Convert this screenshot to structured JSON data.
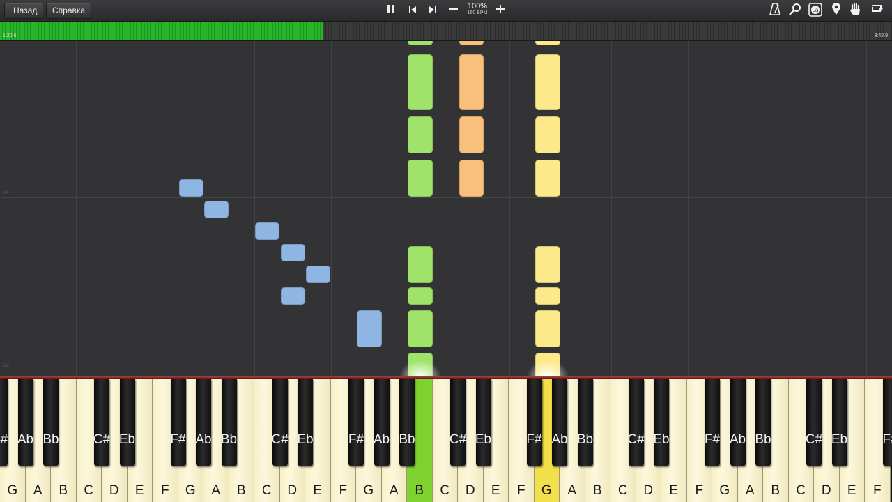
{
  "topbar": {
    "back_label": "Назад",
    "help_label": "Справка",
    "speed_percent": "100%",
    "tempo": "160 BPM"
  },
  "icons": {
    "pause": "pause-icon",
    "prev": "skip-back-icon",
    "next": "skip-forward-icon",
    "minus": "minus-icon",
    "plus": "plus-icon",
    "metronome": "metronome-icon",
    "search": "search-icon",
    "labels": "note-labels-icon",
    "marker": "location-marker-icon",
    "hand": "hand-icon",
    "loop": "loop-icon"
  },
  "progress": {
    "current_time": "1:20.6",
    "total_time": "3:42.9",
    "fraction": 0.362,
    "fill_color": "#22a825"
  },
  "roll": {
    "measure_top": "54",
    "measure_bottom": "53"
  },
  "colors": {
    "blue": "#8fb5e3",
    "green": "#9fe36a",
    "orange": "#f8c07a",
    "yellow": "#fbe98a",
    "active_green": "#7fd12e",
    "active_yellow": "#f2e04a"
  },
  "keyboard": {
    "white_keys": [
      "G",
      "A",
      "B",
      "C",
      "D",
      "E",
      "F",
      "G",
      "A",
      "B",
      "C",
      "D",
      "E",
      "F",
      "G",
      "A",
      "B",
      "C",
      "D",
      "E",
      "F",
      "G",
      "A",
      "B",
      "C",
      "D",
      "E",
      "F",
      "G",
      "A",
      "B",
      "C",
      "D",
      "E",
      "F"
    ],
    "black_keys": [
      "F#",
      "Ab",
      "Bb",
      "C#",
      "Eb",
      "F#",
      "Ab",
      "Bb",
      "C#",
      "Eb",
      "F#",
      "Ab",
      "Bb",
      "C#",
      "Eb",
      "F#",
      "Ab",
      "Bb",
      "C#",
      "Eb",
      "F#",
      "Ab",
      "Bb",
      "C#",
      "Eb",
      "F#"
    ],
    "active_white": {
      "16": "green",
      "21": "yellow"
    }
  }
}
